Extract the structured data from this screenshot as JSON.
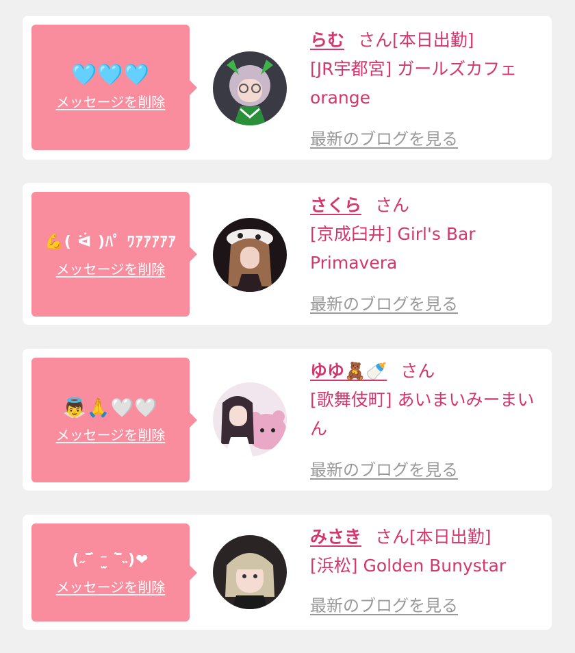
{
  "colors": {
    "page_bg": "#f0f0f0",
    "card_bg": "#ffffff",
    "bubble_bg": "#f98c9d",
    "accent_pink": "#d4366d",
    "link_gray": "#999999"
  },
  "entries": [
    {
      "message": "🩵🩵🩵",
      "delete_label": "メッセージを削除",
      "name": "らむ",
      "suffix": "さん[本日出勤]",
      "shop": "[JR宇都宮] ガールズカフェ orange",
      "blog_label": "最新のブログを見る",
      "avatar_icon": "profile-photo-icon"
    },
    {
      "message": "💪( ᐛ )ﾊﾟ ﾜｱｱｱｱｱ",
      "delete_label": "メッセージを削除",
      "name": "さくら",
      "suffix": "さん",
      "shop": "[京成臼井] Girl's Bar Primavera",
      "blog_label": "最新のブログを見る",
      "avatar_icon": "profile-photo-icon"
    },
    {
      "message": "👼🙏🤍🤍",
      "delete_label": "メッセージを削除",
      "name": "ゆゆ🧸🍼",
      "suffix": "さん",
      "shop": "[歌舞伎町] あいまいみーまいん",
      "blog_label": "最新のブログを見る",
      "avatar_icon": "profile-photo-icon"
    },
    {
      "message": "(˶‾᷄ ⁻̫ ‾᷅˵)❤",
      "delete_label": "メッセージを削除",
      "name": "みさき",
      "suffix": "さん[本日出勤]",
      "shop": "[浜松] Golden Bunystar",
      "blog_label": "最新のブログを見る",
      "avatar_icon": "profile-photo-icon"
    }
  ]
}
